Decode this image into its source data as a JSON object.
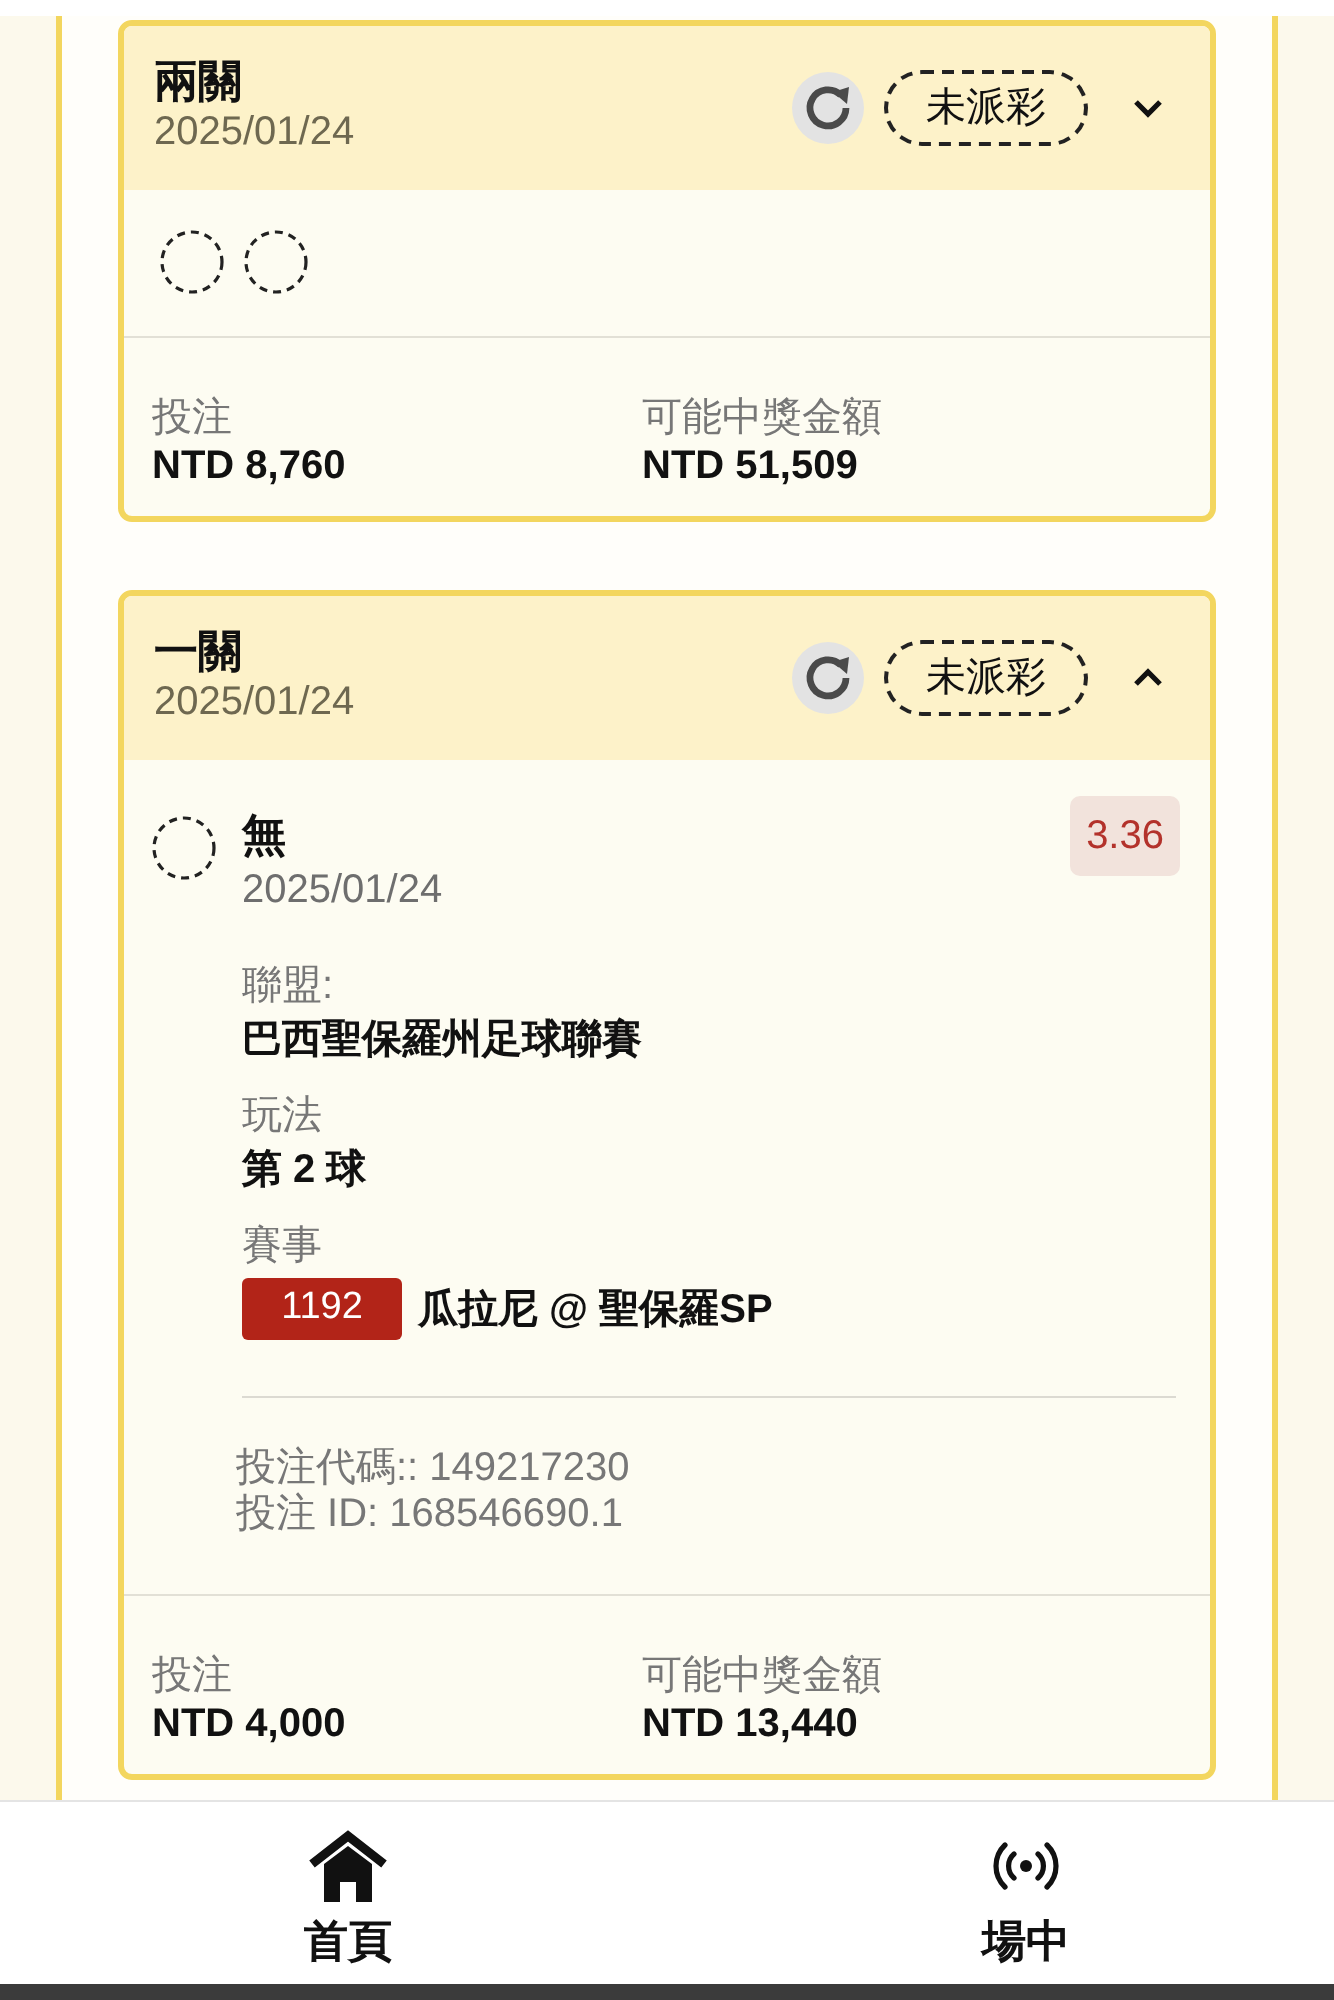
{
  "bets": [
    {
      "title": "兩關",
      "date": "2025/01/24",
      "status": "未派彩",
      "expanded": false,
      "legs": [
        {
          "settled": false
        },
        {
          "settled": false
        }
      ],
      "stake_label": "投注",
      "stake": "NTD 8,760",
      "payout_label": "可能中獎金額",
      "payout": "NTD 51,509"
    },
    {
      "title": "一關",
      "date": "2025/01/24",
      "status": "未派彩",
      "expanded": true,
      "legs": [
        {
          "settled": false,
          "selection": "無",
          "date": "2025/01/24",
          "odds": "3.36",
          "details": [
            {
              "kind": "text",
              "label": "聯盟:",
              "value": "巴西聖保羅州足球聯賽"
            },
            {
              "kind": "text",
              "label": "玩法",
              "value": "第 2 球"
            },
            {
              "kind": "match",
              "label": "賽事",
              "match_no": "1192",
              "value": "瓜拉尼 @ 聖保羅SP"
            }
          ]
        }
      ],
      "bet_code": "投注代碼:: 149217230",
      "bet_id": "投注 ID: 168546690.1",
      "stake_label": "投注",
      "stake": "NTD 4,000",
      "payout_label": "可能中獎金額",
      "payout": "NTD 13,440"
    }
  ],
  "nav": [
    {
      "kind": "home",
      "label": "首頁"
    },
    {
      "kind": "live",
      "label": "場中"
    }
  ]
}
